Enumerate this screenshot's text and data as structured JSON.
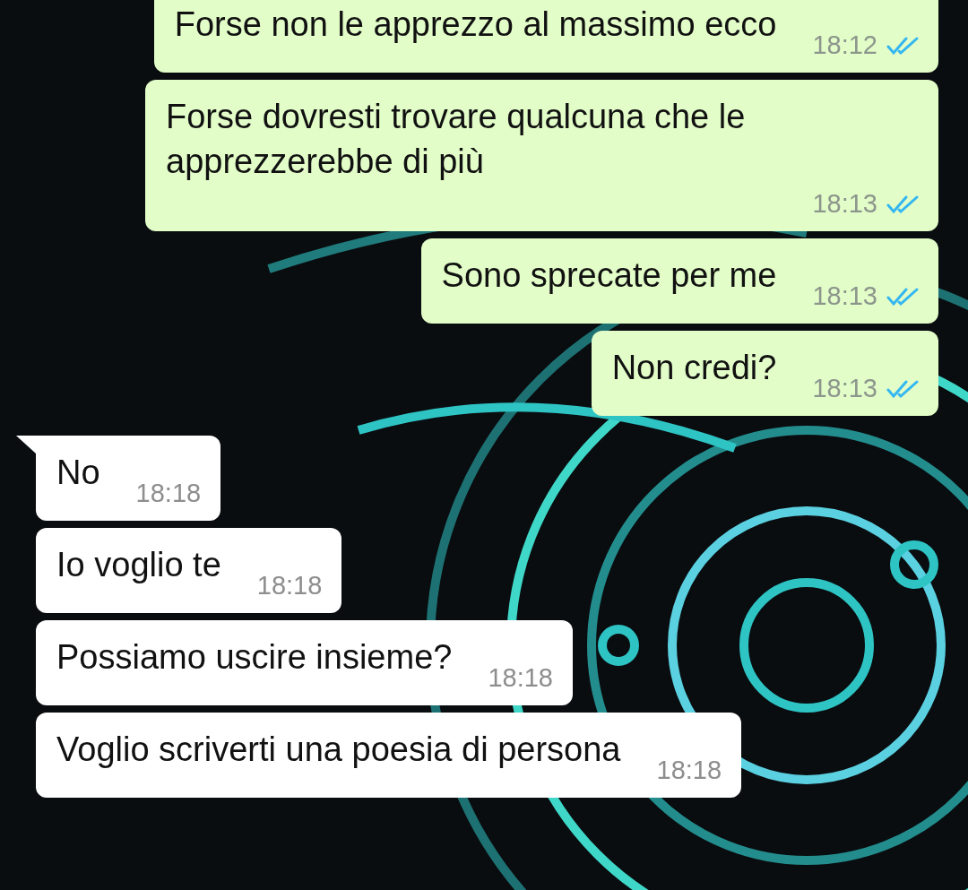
{
  "messages": [
    {
      "kind": "outgoing",
      "text": "Forse non le apprezzo al massimo ecco",
      "time": "18:12",
      "read": true,
      "tail": false
    },
    {
      "kind": "outgoing",
      "text": "Forse dovresti trovare qualcuna che le apprezzerebbe di più",
      "time": "18:13",
      "read": true,
      "tail": false
    },
    {
      "kind": "outgoing",
      "text": "Sono sprecate per me",
      "time": "18:13",
      "read": true,
      "tail": false
    },
    {
      "kind": "outgoing",
      "text": "Non credi?",
      "time": "18:13",
      "read": true,
      "tail": false
    },
    {
      "kind": "incoming",
      "text": "No",
      "time": "18:18",
      "tail": true
    },
    {
      "kind": "incoming",
      "text": "Io voglio te",
      "time": "18:18",
      "tail": false
    },
    {
      "kind": "incoming",
      "text": "Possiamo uscire insieme?",
      "time": "18:18",
      "tail": false
    },
    {
      "kind": "incoming",
      "text": "Voglio scriverti una poesia di persona",
      "time": "18:18",
      "tail": false
    }
  ]
}
